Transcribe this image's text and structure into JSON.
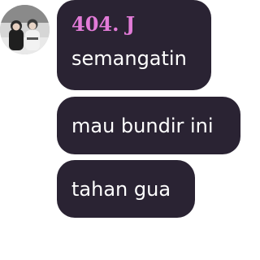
{
  "avatar": {
    "icon": "profile-photo-icon"
  },
  "messages": [
    {
      "sender": "404. J",
      "text": "semangatin"
    },
    {
      "text": "mau bundir ini"
    },
    {
      "text": "tahan gua"
    }
  ],
  "colors": {
    "bubble": "#2a2333",
    "sender_name": "#e27bd8",
    "text": "#ffffff"
  }
}
